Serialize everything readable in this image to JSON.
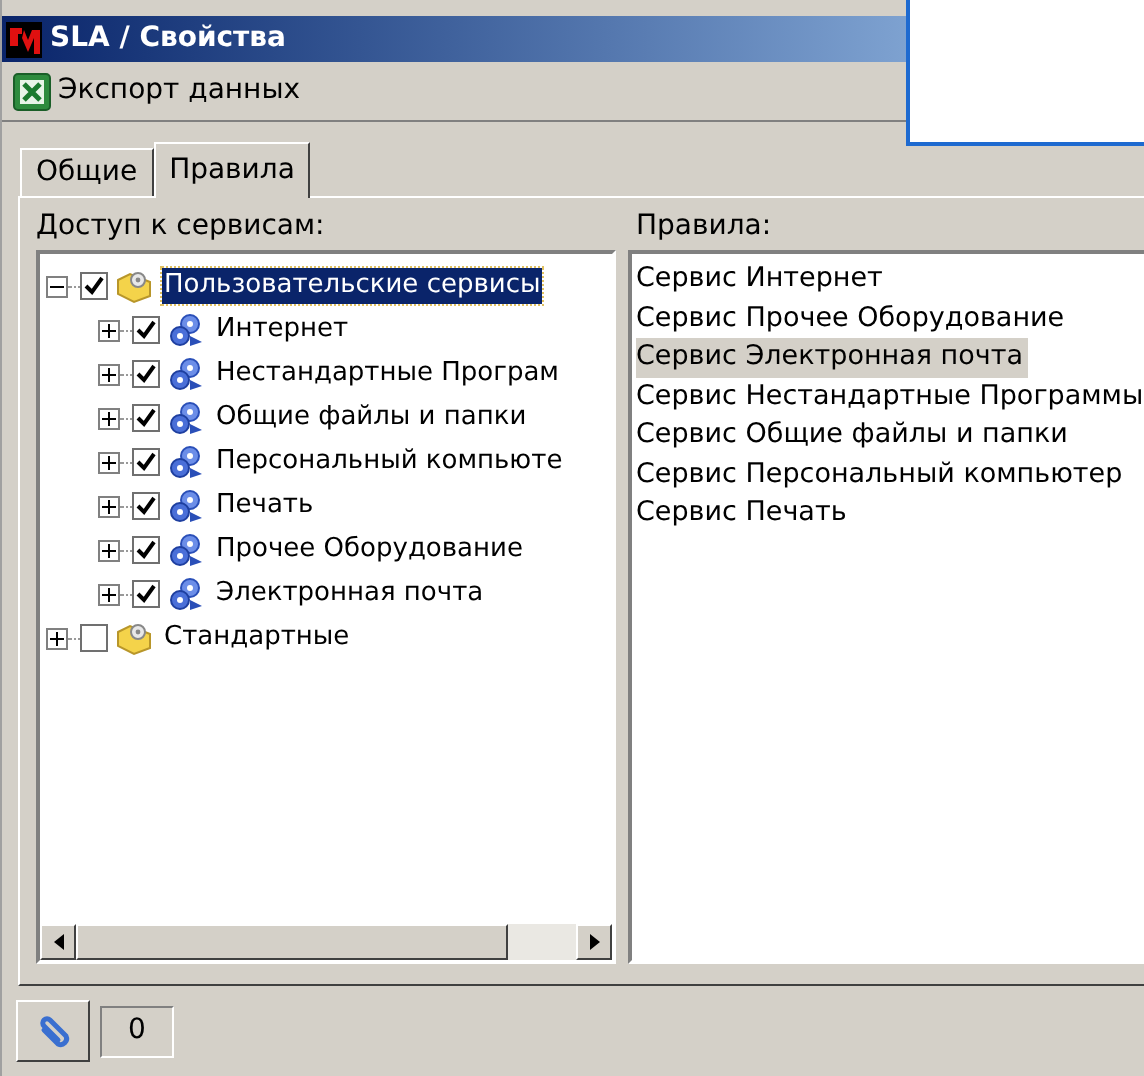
{
  "window": {
    "title": "SLA / Свойства"
  },
  "toolbar": {
    "export_button": "Экспорт данных"
  },
  "tabs": [
    {
      "label": "Общие",
      "selected": false
    },
    {
      "label": "Правила",
      "selected": true
    }
  ],
  "access": {
    "label": "Доступ к сервисам:",
    "tree": [
      {
        "label": "Пользовательские сервисы",
        "checked": true,
        "expanded": true,
        "selected": true,
        "children": [
          {
            "label": "Интернет",
            "checked": true,
            "expanded": false,
            "selected": false
          },
          {
            "label": "Нестандартные Програм",
            "checked": true,
            "expanded": false,
            "selected": false
          },
          {
            "label": "Общие файлы и папки",
            "checked": true,
            "expanded": false,
            "selected": false
          },
          {
            "label": "Персональный компьюте",
            "checked": true,
            "expanded": false,
            "selected": false
          },
          {
            "label": "Печать",
            "checked": true,
            "expanded": false,
            "selected": false
          },
          {
            "label": "Прочее Оборудование",
            "checked": true,
            "expanded": false,
            "selected": false
          },
          {
            "label": "Электронная почта",
            "checked": true,
            "expanded": false,
            "selected": false
          }
        ]
      },
      {
        "label": "Стандартные",
        "checked": false,
        "expanded": false,
        "selected": false
      }
    ]
  },
  "rules": {
    "label": "Правила:",
    "items": [
      {
        "label": "Сервис Интернет",
        "selected": false
      },
      {
        "label": "Сервис Прочее Оборудование",
        "selected": false
      },
      {
        "label": "Сервис Электронная почта",
        "selected": true
      },
      {
        "label": "Сервис Нестандартные Программы",
        "selected": false
      },
      {
        "label": "Сервис Общие файлы и папки",
        "selected": false
      },
      {
        "label": "Сервис Персональный компьютер",
        "selected": false
      },
      {
        "label": "Сервис Печать",
        "selected": false
      }
    ]
  },
  "footer": {
    "attachments_count": "0"
  }
}
